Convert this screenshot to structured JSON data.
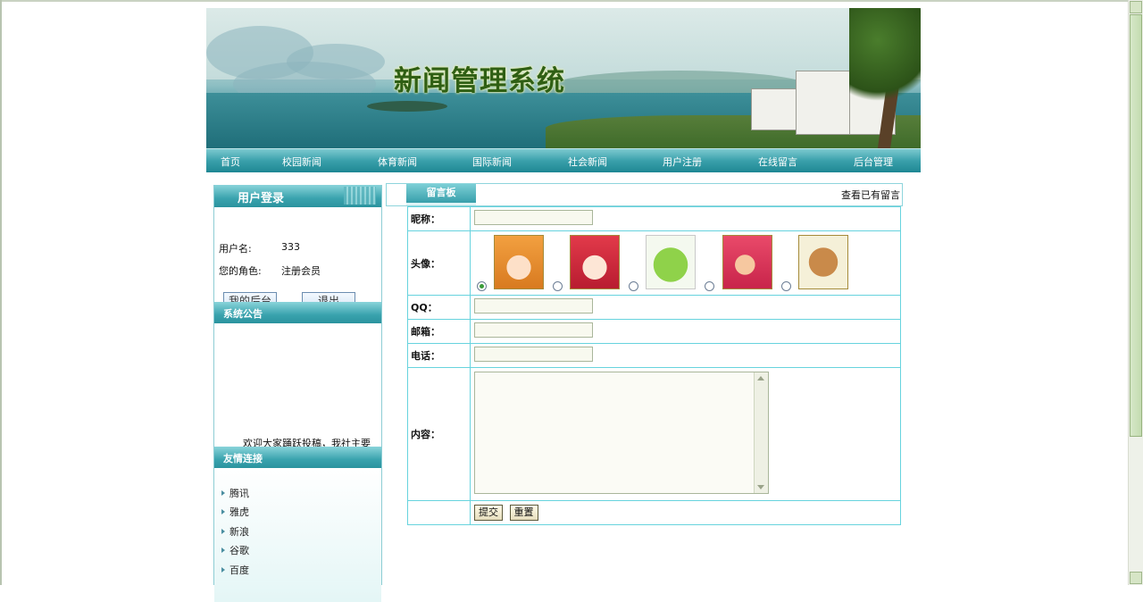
{
  "banner": {
    "title": "新闻管理系统"
  },
  "nav": {
    "items": [
      "首页",
      "校园新闻",
      "体育新闻",
      "国际新闻",
      "社会新闻",
      "用户注册",
      "在线留言",
      "后台管理"
    ]
  },
  "login": {
    "header": "用户登录",
    "username_label": "用户名:",
    "username_value": "333",
    "role_label": "您的角色:",
    "role_value": "注册会员",
    "backend_button": "我的后台",
    "logout_button": "退出"
  },
  "notice": {
    "header": "系统公告",
    "marquee_text": "欢迎大家踊跃投稿，我社主要"
  },
  "links": {
    "header": "友情连接",
    "items": [
      "腾讯",
      "雅虎",
      "新浪",
      "谷歌",
      "百度"
    ]
  },
  "board": {
    "tab": "留言板",
    "view_link": "查看已有留言",
    "nickname_label": "昵称：",
    "avatar_label": "头像：",
    "qq_label": "QQ：",
    "email_label": "邮箱：",
    "phone_label": "电话：",
    "content_label": "内容：",
    "nickname_value": "",
    "qq_value": "",
    "email_value": "",
    "phone_value": "",
    "content_value": "",
    "avatars": [
      "girl-avatar",
      "red-hair-girl-avatar",
      "frog-avatar",
      "helmet-kid-avatar",
      "bear-avatar"
    ],
    "selected_avatar": 0,
    "submit_button": "提交",
    "reset_button": "重置"
  },
  "colors": {
    "accent": "#2e98a4",
    "nav_text": "#ffffff",
    "title": "#2f5f14"
  }
}
